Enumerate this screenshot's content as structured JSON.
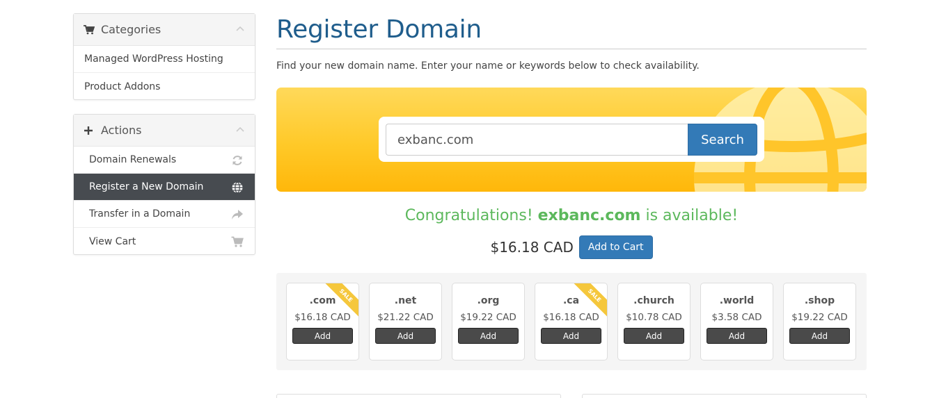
{
  "sidebar": {
    "categories": {
      "title": "Categories",
      "items": [
        {
          "label": "Managed WordPress Hosting"
        },
        {
          "label": "Product Addons"
        }
      ]
    },
    "actions": {
      "title": "Actions",
      "items": [
        {
          "label": "Domain Renewals",
          "icon": "refresh-icon"
        },
        {
          "label": "Register a New Domain",
          "icon": "globe-icon",
          "active": true
        },
        {
          "label": "Transfer in a Domain",
          "icon": "share-arrow-icon"
        },
        {
          "label": "View Cart",
          "icon": "cart-icon"
        }
      ]
    }
  },
  "main": {
    "title": "Register Domain",
    "intro": "Find your new domain name. Enter your name or keywords below to check availability.",
    "search": {
      "value": "exbanc.com",
      "button": "Search"
    },
    "result": {
      "prefix": "Congratulations! ",
      "domain": "exbanc.com",
      "suffix": " is available!",
      "price": "$16.18 CAD",
      "cart_button": "Add to Cart"
    },
    "tlds": [
      {
        "name": ".com",
        "price": "$16.18 CAD",
        "add": "Add",
        "sale": "SALE"
      },
      {
        "name": ".net",
        "price": "$21.22 CAD",
        "add": "Add"
      },
      {
        "name": ".org",
        "price": "$19.22 CAD",
        "add": "Add"
      },
      {
        "name": ".ca",
        "price": "$16.18 CAD",
        "add": "Add",
        "sale": "SALE"
      },
      {
        "name": ".church",
        "price": "$10.78 CAD",
        "add": "Add"
      },
      {
        "name": ".world",
        "price": "$3.58 CAD",
        "add": "Add"
      },
      {
        "name": ".shop",
        "price": "$19.22 CAD",
        "add": "Add"
      }
    ]
  },
  "colors": {
    "title": "#1f5d8c",
    "primary": "#337ab7",
    "success": "#5cb85c",
    "banner": "#ffc928",
    "active_nav": "#474b50"
  }
}
